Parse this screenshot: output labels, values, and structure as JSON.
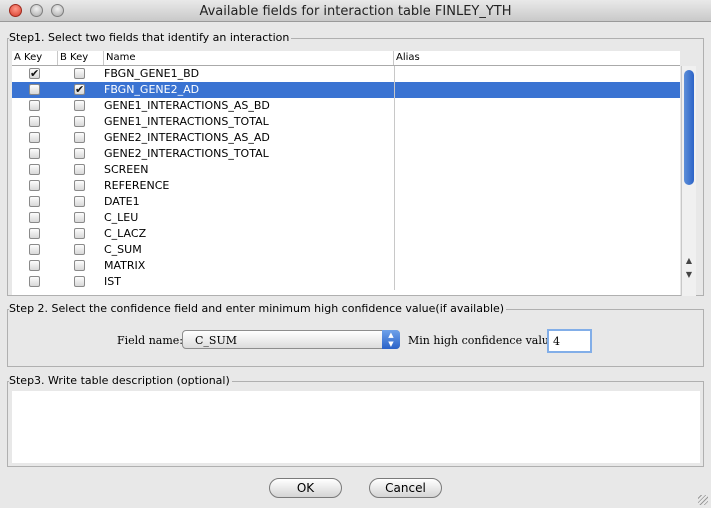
{
  "window": {
    "title": "Available fields for interaction table FINLEY_YTH"
  },
  "step1": {
    "legend": "Step1. Select two fields that identify an interaction",
    "columns": {
      "akey": "A Key",
      "bkey": "B Key",
      "name": "Name",
      "alias": "Alias"
    },
    "rows": [
      {
        "name": "FBGN_GENE1_BD",
        "a": true,
        "b": false,
        "selected": false
      },
      {
        "name": "FBGN_GENE2_AD",
        "a": false,
        "b": true,
        "selected": true
      },
      {
        "name": "GENE1_INTERACTIONS_AS_BD",
        "a": false,
        "b": false,
        "selected": false
      },
      {
        "name": "GENE1_INTERACTIONS_TOTAL",
        "a": false,
        "b": false,
        "selected": false
      },
      {
        "name": "GENE2_INTERACTIONS_AS_AD",
        "a": false,
        "b": false,
        "selected": false
      },
      {
        "name": "GENE2_INTERACTIONS_TOTAL",
        "a": false,
        "b": false,
        "selected": false
      },
      {
        "name": "SCREEN",
        "a": false,
        "b": false,
        "selected": false
      },
      {
        "name": "REFERENCE",
        "a": false,
        "b": false,
        "selected": false
      },
      {
        "name": "DATE1",
        "a": false,
        "b": false,
        "selected": false
      },
      {
        "name": "C_LEU",
        "a": false,
        "b": false,
        "selected": false
      },
      {
        "name": "C_LACZ",
        "a": false,
        "b": false,
        "selected": false
      },
      {
        "name": "C_SUM",
        "a": false,
        "b": false,
        "selected": false
      },
      {
        "name": "MATRIX",
        "a": false,
        "b": false,
        "selected": false
      },
      {
        "name": "IST",
        "a": false,
        "b": false,
        "selected": false
      }
    ]
  },
  "step2": {
    "legend": "Step 2. Select the confidence field and enter minimum high confidence value(if available)",
    "field_label": "Field name:",
    "field_value": "C_SUM",
    "min_label": "Min high confidence value:",
    "min_value": "4"
  },
  "step3": {
    "legend": "Step3. Write table description (optional)"
  },
  "buttons": {
    "ok": "OK",
    "cancel": "Cancel"
  },
  "icons": {
    "check": "check-icon",
    "up": "arrow-up-icon",
    "down": "arrow-down-icon"
  },
  "colors": {
    "selection": "#3a73d2",
    "scroll_thumb": "#2c64c8"
  }
}
